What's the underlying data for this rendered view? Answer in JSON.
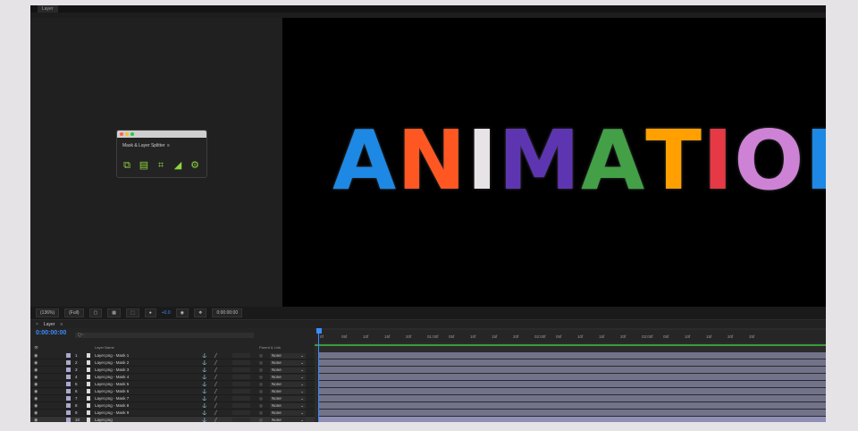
{
  "window": {
    "tab_label": "Layer"
  },
  "plugin_panel": {
    "title": "Mask & Layer Splitter",
    "menu_glyph": "≡",
    "icons": [
      "layer-split-icon",
      "align-icon",
      "crop-icon",
      "stairs-icon",
      "settings-icon"
    ]
  },
  "viewer": {
    "letters": [
      {
        "char": "A",
        "color": "#1e88e5"
      },
      {
        "char": "N",
        "color": "#ff5722"
      },
      {
        "char": "I",
        "color": "#e8e3e6"
      },
      {
        "char": "M",
        "color": "#5e35b1"
      },
      {
        "char": "A",
        "color": "#43a047"
      },
      {
        "char": "T",
        "color": "#ffa000"
      },
      {
        "char": "I",
        "color": "#e53946"
      },
      {
        "char": "O",
        "color": "#ce82d6"
      },
      {
        "char": "N",
        "color": "#1e88e5"
      }
    ]
  },
  "viewer_bar": {
    "zoom": "(136%)",
    "resolution": "(Full)",
    "exposure": "+0.0",
    "timecode": "0:00:00:00"
  },
  "timeline": {
    "tab_label": "Layer",
    "current_time": "0:00:00:00",
    "search_placeholder": "Q~",
    "columns": {
      "layer_name": "Layer Name",
      "parent": "Parent & Link"
    },
    "layers": [
      {
        "num": "1",
        "name": "Layer.png - Mask 1",
        "parent": "None"
      },
      {
        "num": "2",
        "name": "Layer.png - Mask 2",
        "parent": "None"
      },
      {
        "num": "3",
        "name": "Layer.png - Mask 3",
        "parent": "None"
      },
      {
        "num": "4",
        "name": "Layer.png - Mask 4",
        "parent": "None"
      },
      {
        "num": "5",
        "name": "Layer.png - Mask 5",
        "parent": "None"
      },
      {
        "num": "6",
        "name": "Layer.png - Mask 6",
        "parent": "None"
      },
      {
        "num": "7",
        "name": "Layer.png - Mask 7",
        "parent": "None"
      },
      {
        "num": "8",
        "name": "Layer.png - Mask 8",
        "parent": "None"
      },
      {
        "num": "9",
        "name": "Layer.png - Mask 9",
        "parent": "None"
      },
      {
        "num": "10",
        "name": "Layer.png",
        "parent": "None"
      }
    ],
    "ruler": [
      "0f",
      "05f",
      "10f",
      "15f",
      "20f",
      "01:00f",
      "05f",
      "10f",
      "15f",
      "20f",
      "02:00f",
      "05f",
      "10f",
      "15f",
      "20f",
      "03:00f",
      "05f",
      "10f",
      "15f",
      "20f",
      "25f"
    ]
  }
}
